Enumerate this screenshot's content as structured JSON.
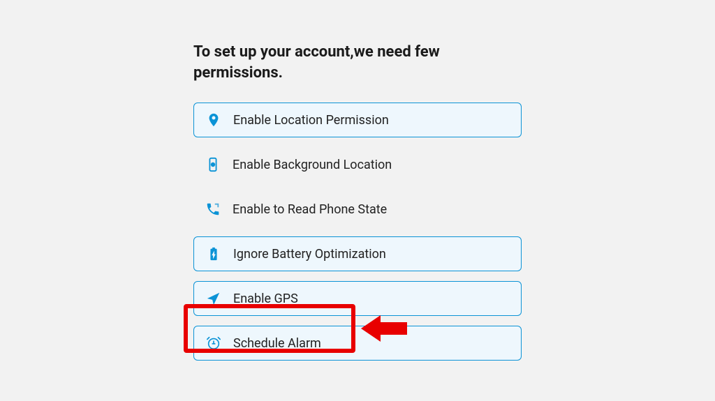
{
  "title": "To set up your account,we need few permissions.",
  "permissions": [
    {
      "label": "Enable Location Permission",
      "style": "boxed",
      "icon": "location-pin-icon"
    },
    {
      "label": "Enable Background Location",
      "style": "plain",
      "icon": "phone-location-icon"
    },
    {
      "label": "Enable to Read Phone State",
      "style": "plain",
      "icon": "phone-state-icon"
    },
    {
      "label": "Ignore Battery Optimization",
      "style": "boxed",
      "icon": "battery-icon"
    },
    {
      "label": "Enable GPS",
      "style": "boxed",
      "icon": "navigation-icon"
    },
    {
      "label": "Schedule Alarm",
      "style": "boxed",
      "icon": "alarm-icon"
    }
  ],
  "annotation": {
    "highlight_target": "Schedule Alarm",
    "arrow_color": "#e80000"
  }
}
